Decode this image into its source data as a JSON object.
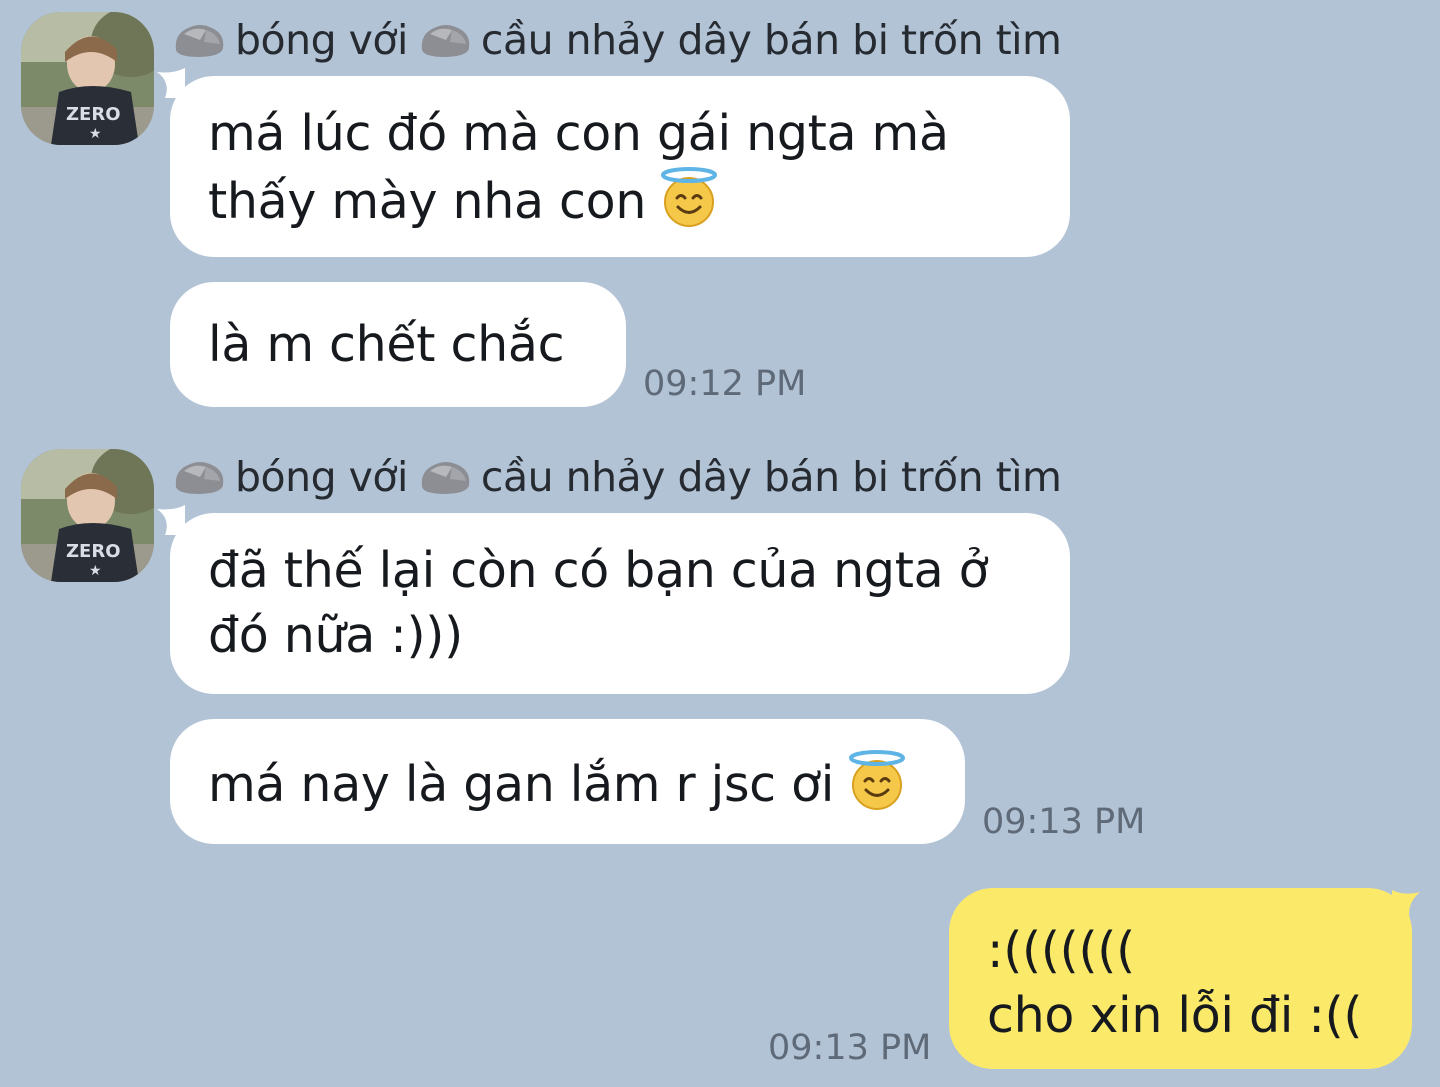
{
  "groups": [
    {
      "sender_prefix_word": "bóng với",
      "sender_suffix": "cầu nhảy dây bán bi trốn tìm",
      "messages": [
        {
          "lines": [
            "má lúc đó mà con gái ngta mà",
            "thấy mày nha con"
          ],
          "emoji": "smiling-face-with-halo"
        },
        {
          "lines": [
            "là m chết chắc"
          ]
        }
      ],
      "time": "09:12 PM"
    },
    {
      "sender_prefix_word": "bóng với",
      "sender_suffix": "cầu nhảy dây bán bi trốn tìm",
      "messages": [
        {
          "lines": [
            "đã thế lại còn có bạn của ngta ở",
            "đó nữa :)))"
          ]
        },
        {
          "lines": [
            "má nay là gan lắm r jsc ơi"
          ],
          "emoji": "smiling-face-with-halo"
        }
      ],
      "time": "09:13 PM"
    }
  ],
  "outgoing": {
    "lines": [
      ":((((((( ",
      "cho xin lỗi đi :(("
    ],
    "time": "09:13 PM"
  },
  "colors": {
    "background": "#b3c3d6",
    "incoming_bubble": "#ffffff",
    "outgoing_bubble": "#fbe96a"
  }
}
